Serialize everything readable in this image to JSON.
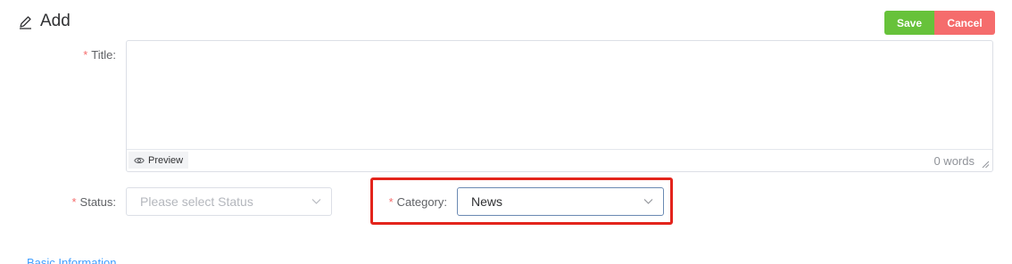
{
  "header": {
    "title": "Add",
    "icon": "pencil-icon"
  },
  "actions": {
    "save_label": "Save",
    "cancel_label": "Cancel",
    "save_color": "#67c23a",
    "cancel_color": "#f56c6c"
  },
  "form": {
    "required_marker": "*",
    "title": {
      "label": "Title:",
      "value": "",
      "preview_label": "Preview",
      "word_count": "0 words"
    },
    "status": {
      "label": "Status:",
      "placeholder": "Please select Status",
      "value": ""
    },
    "category": {
      "label": "Category:",
      "value": "News"
    }
  },
  "highlight_color": "#e3241c",
  "cutoff_section_text": "Basic Information"
}
